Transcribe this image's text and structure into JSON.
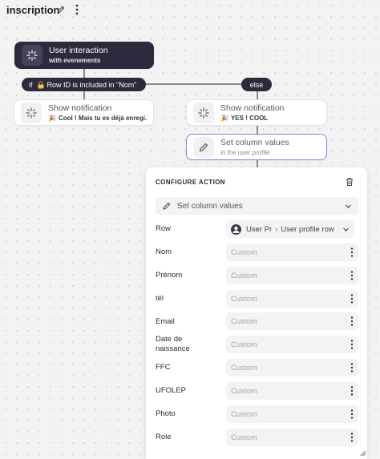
{
  "header": {
    "title": "inscription"
  },
  "flow": {
    "trigger": {
      "title": "User interaction",
      "subtitle": "with evenements"
    },
    "condition_if": {
      "prefix": "if",
      "text": "Row ID is included in \"Nom\""
    },
    "condition_else": {
      "text": "else"
    },
    "left_action": {
      "title": "Show notification",
      "subtitle": "Cool ! Mais tu es déjà enregi..."
    },
    "right_action": {
      "title": "Show notification",
      "subtitle": "YES ! COOL"
    },
    "set_action": {
      "title": "Set column values",
      "subtitle": "in the user profile"
    }
  },
  "panel": {
    "title": "CONFIGURE ACTION",
    "action_value": "Set column values",
    "row": {
      "label": "Row",
      "value_short": "User Pr",
      "value": "User profile row"
    },
    "fields": [
      {
        "label": "Nom",
        "placeholder": "Custom"
      },
      {
        "label": "Prénom",
        "placeholder": "Custom"
      },
      {
        "label": "tél",
        "placeholder": "Custom"
      },
      {
        "label": "Email",
        "placeholder": "Custom"
      },
      {
        "label": "Date de naissance",
        "placeholder": "Custom"
      },
      {
        "label": "FFC",
        "placeholder": "Custom"
      },
      {
        "label": "UFOLEP",
        "placeholder": "Custom"
      },
      {
        "label": "Photo",
        "placeholder": "Custom"
      },
      {
        "label": "Role",
        "placeholder": "Custom"
      }
    ]
  },
  "icons": {
    "edit": "pencil-icon",
    "menu": "kebab-icon",
    "trigger": "sparkle-icon",
    "lock": "lock-icon",
    "notification": "party-icon",
    "delete": "trash-icon",
    "chevron": "chevron-down-icon",
    "user": "avatar-icon"
  },
  "colors": {
    "node_dark": "#2c2a3d",
    "selected_border": "#7c8ad9",
    "field_bg": "#f3f3f5"
  }
}
